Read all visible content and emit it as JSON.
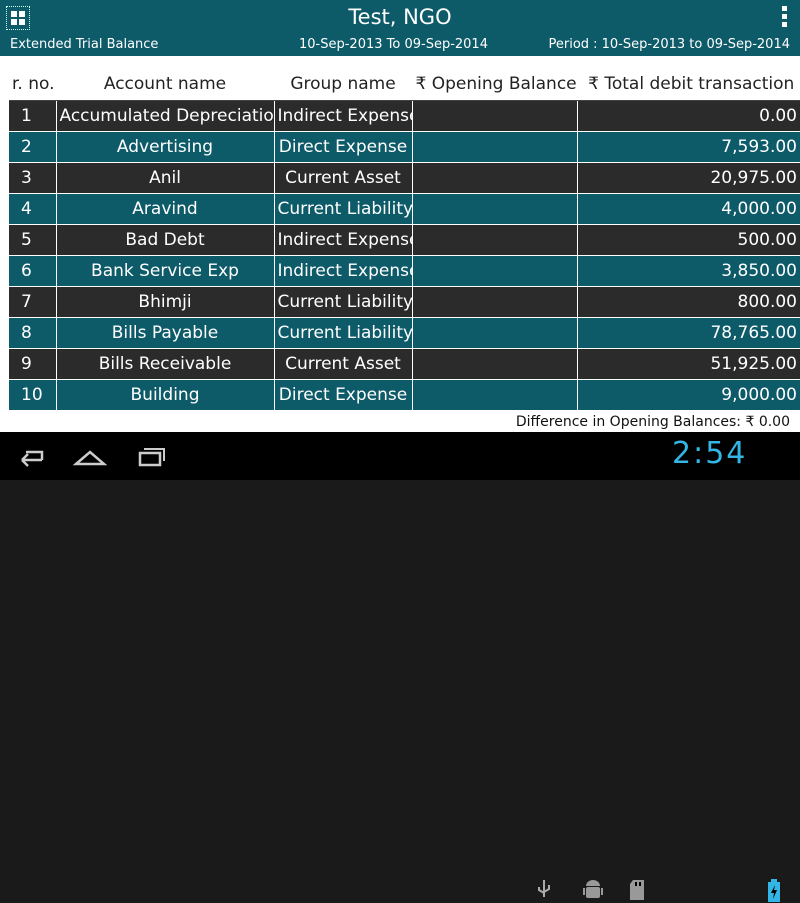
{
  "header": {
    "title": "Test, NGO",
    "report_name": "Extended Trial Balance",
    "date_range": "10-Sep-2013 To 09-Sep-2014",
    "period": "Period : 10-Sep-2013 to 09-Sep-2014"
  },
  "table": {
    "columns": [
      "r. no.",
      "Account name",
      "Group name",
      "₹ Opening  Balance",
      "₹ Total  debit  transaction"
    ],
    "rows": [
      [
        "1",
        "Accumulated Depreciation",
        "Indirect Expense",
        "",
        "0.00"
      ],
      [
        "2",
        "Advertising",
        "Direct Expense",
        "",
        "7,593.00"
      ],
      [
        "3",
        "Anil",
        "Current Asset",
        "",
        "20,975.00"
      ],
      [
        "4",
        "Aravind",
        "Current Liability",
        "",
        "4,000.00"
      ],
      [
        "5",
        "Bad Debt",
        "Indirect Expense",
        "",
        "500.00"
      ],
      [
        "6",
        "Bank Service Exp",
        "Indirect Expense",
        "",
        "3,850.00"
      ],
      [
        "7",
        "Bhimji",
        "Current Liability",
        "",
        "800.00"
      ],
      [
        "8",
        "Bills Payable",
        "Current Liability",
        "",
        "78,765.00"
      ],
      [
        "9",
        "Bills Receivable",
        "Current Asset",
        "",
        "51,925.00"
      ],
      [
        "10",
        "Building",
        "Direct Expense",
        "",
        "9,000.00"
      ]
    ]
  },
  "footer": {
    "difference": "Difference in Opening Balances: ₹ 0.00"
  },
  "system": {
    "clock": "2:54"
  },
  "colors": {
    "accent": "#0d5a68",
    "row_dark": "#2b2b2b",
    "clock": "#33b5e5"
  }
}
